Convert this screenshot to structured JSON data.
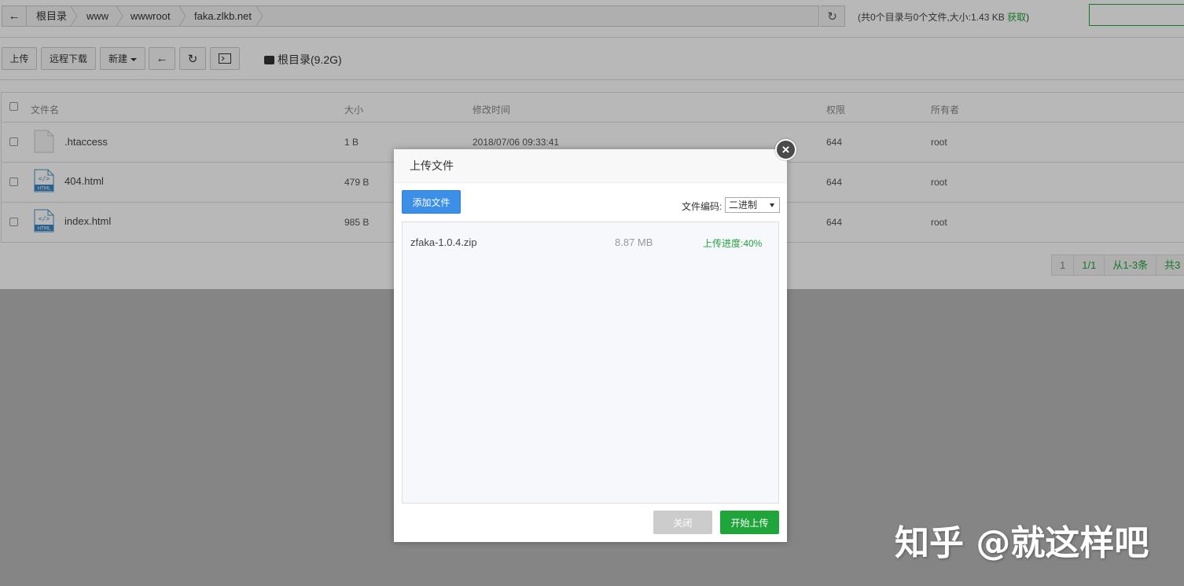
{
  "breadcrumb": {
    "items": [
      "根目录",
      "www",
      "wwwroot",
      "faka.zlkb.net"
    ]
  },
  "dir_info": {
    "summary": "(共0个目录与0个文件,大小:1.43 KB",
    "get_link": "获取",
    "close_paren": ")"
  },
  "toolbar": {
    "upload": "上传",
    "remote_download": "远程下载",
    "new": "新建",
    "disk": "根目录(9.2G)"
  },
  "table": {
    "headers": {
      "name": "文件名",
      "size": "大小",
      "mtime": "修改时间",
      "perm": "权限",
      "owner": "所有者"
    },
    "rows": [
      {
        "name": ".htaccess",
        "size": "1 B",
        "mtime": "2018/07/06 09:33:41",
        "perm": "644",
        "owner": "root",
        "icon": "file-icon"
      },
      {
        "name": "404.html",
        "size": "479 B",
        "mtime": "",
        "perm": "644",
        "owner": "root",
        "icon": "html-file-icon"
      },
      {
        "name": "index.html",
        "size": "985 B",
        "mtime": "",
        "perm": "644",
        "owner": "root",
        "icon": "html-file-icon"
      }
    ]
  },
  "pager": {
    "page": "1",
    "pages": "1/1",
    "range": "从1-3条",
    "total": "共3"
  },
  "modal": {
    "title": "上传文件",
    "add_file": "添加文件",
    "encoding_label": "文件编码:",
    "encoding_value": "二进制",
    "file": {
      "name": "zfaka-1.0.4.zip",
      "size": "8.87 MB",
      "progress_text": "上传进度:40%",
      "progress": 0.4
    },
    "close": "关闭",
    "start": "开始上传"
  },
  "icon_labels": {
    "html": "HTML"
  },
  "watermark": "知乎 @就这样吧",
  "colors": {
    "accent_green": "#20a53a",
    "add_button_blue": "#3c8fe6"
  }
}
